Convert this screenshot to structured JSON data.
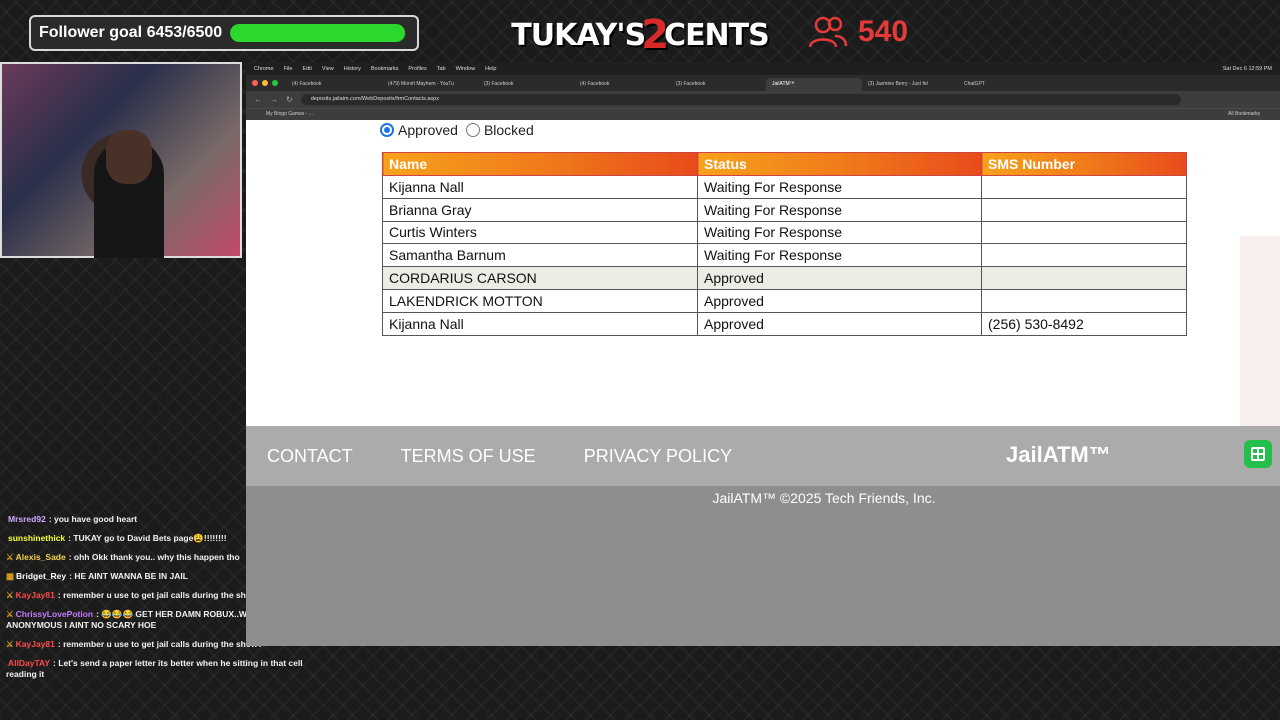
{
  "overlay": {
    "follower_goal": {
      "label": "Follower goal 6453/6500",
      "current": 6453,
      "target": 6500
    },
    "logo_text_a": "TUKAY'S",
    "logo_text_b": "2",
    "logo_text_c": "CENTS",
    "viewer_count": "540",
    "colors": {
      "goal_fill": "#2bd82b",
      "viewer": "#e53a3a"
    }
  },
  "chat": [
    {
      "user": "Mrsred92",
      "color": "#c9a8ff",
      "text": "you have good heart",
      "badge": ""
    },
    {
      "user": "sunshinethick",
      "color": "#f6ff3a",
      "text": "TUKAY go to David Bets page😩!!!!!!!!",
      "badge": ""
    },
    {
      "user": "Alexis_Sade",
      "color": "#f5d34a",
      "text": "ohh Okk thank you.. why this happen tho",
      "badge": "⚔"
    },
    {
      "user": "Bridget_Rey",
      "color": "#ffffff",
      "text": "HE AINT WANNA BE IN JAIL",
      "badge": "▦"
    },
    {
      "user": "KayJay81",
      "color": "#ff4a4a",
      "text": "remember u use to get jail calls during the show?",
      "badge": "⚔"
    },
    {
      "user": "ChrissyLovePotion",
      "color": "#c57bff",
      "text": "😂😂😂 GET HER DAMN ROBUX..WHY IT SAY ANONYMOUS I AINT NO SCARY HOE",
      "badge": "⚔"
    },
    {
      "user": "KayJay81",
      "color": "#ff4a4a",
      "text": "remember u use to get jail calls during the show?",
      "badge": "⚔"
    },
    {
      "user": "AllDayTAY",
      "color": "#ff4a4a",
      "text": "Let's send a paper letter its better when he sitting in that cell reading it",
      "badge": ""
    }
  ],
  "browser": {
    "menubar": [
      "Chrome",
      "File",
      "Edit",
      "View",
      "History",
      "Bookmarks",
      "Profiles",
      "Tab",
      "Window",
      "Help"
    ],
    "clock": "Sat Dec 6  12:59 PM",
    "tabs": [
      {
        "label": "(4) Facebook",
        "active": false
      },
      {
        "label": "(479) Monét Mayhem - YouTu",
        "active": false
      },
      {
        "label": "(3) Facebook",
        "active": false
      },
      {
        "label": "(4) Facebook",
        "active": false
      },
      {
        "label": "(3) Facebook",
        "active": false
      },
      {
        "label": "JailATM™",
        "active": true
      },
      {
        "label": "(3) Jasmine Berry - Just fel",
        "active": false
      },
      {
        "label": "ChatGPT",
        "active": false
      }
    ],
    "url": "deposits.jailatm.com/WebDeposits/frmContacts.aspx",
    "bookmark_item": "My Bingo Games - ...",
    "all_bookmarks": "All Bookmarks"
  },
  "page": {
    "filters": {
      "approved_label": "Approved",
      "blocked_label": "Blocked",
      "selected": "approved"
    },
    "table": {
      "headers": {
        "name": "Name",
        "status": "Status",
        "sms": "SMS Number"
      },
      "rows": [
        {
          "name": "Kijanna Nall",
          "status": "Waiting For Response",
          "sms": ""
        },
        {
          "name": "Brianna Gray",
          "status": "Waiting For Response",
          "sms": ""
        },
        {
          "name": "Curtis Winters",
          "status": "Waiting For Response",
          "sms": ""
        },
        {
          "name": "Samantha Barnum",
          "status": "Waiting For Response",
          "sms": ""
        },
        {
          "name": "CORDARIUS CARSON",
          "status": "Approved",
          "sms": ""
        },
        {
          "name": "LAKENDRICK MOTTON",
          "status": "Approved",
          "sms": ""
        },
        {
          "name": "Kijanna Nall",
          "status": "Approved",
          "sms": "(256) 530-8492"
        }
      ]
    },
    "footer": {
      "contact": "CONTACT",
      "terms": "TERMS OF USE",
      "privacy": "PRIVACY POLICY",
      "logo": "JailATM™",
      "copyright": "JailATM™ ©2025 Tech Friends, Inc."
    }
  }
}
